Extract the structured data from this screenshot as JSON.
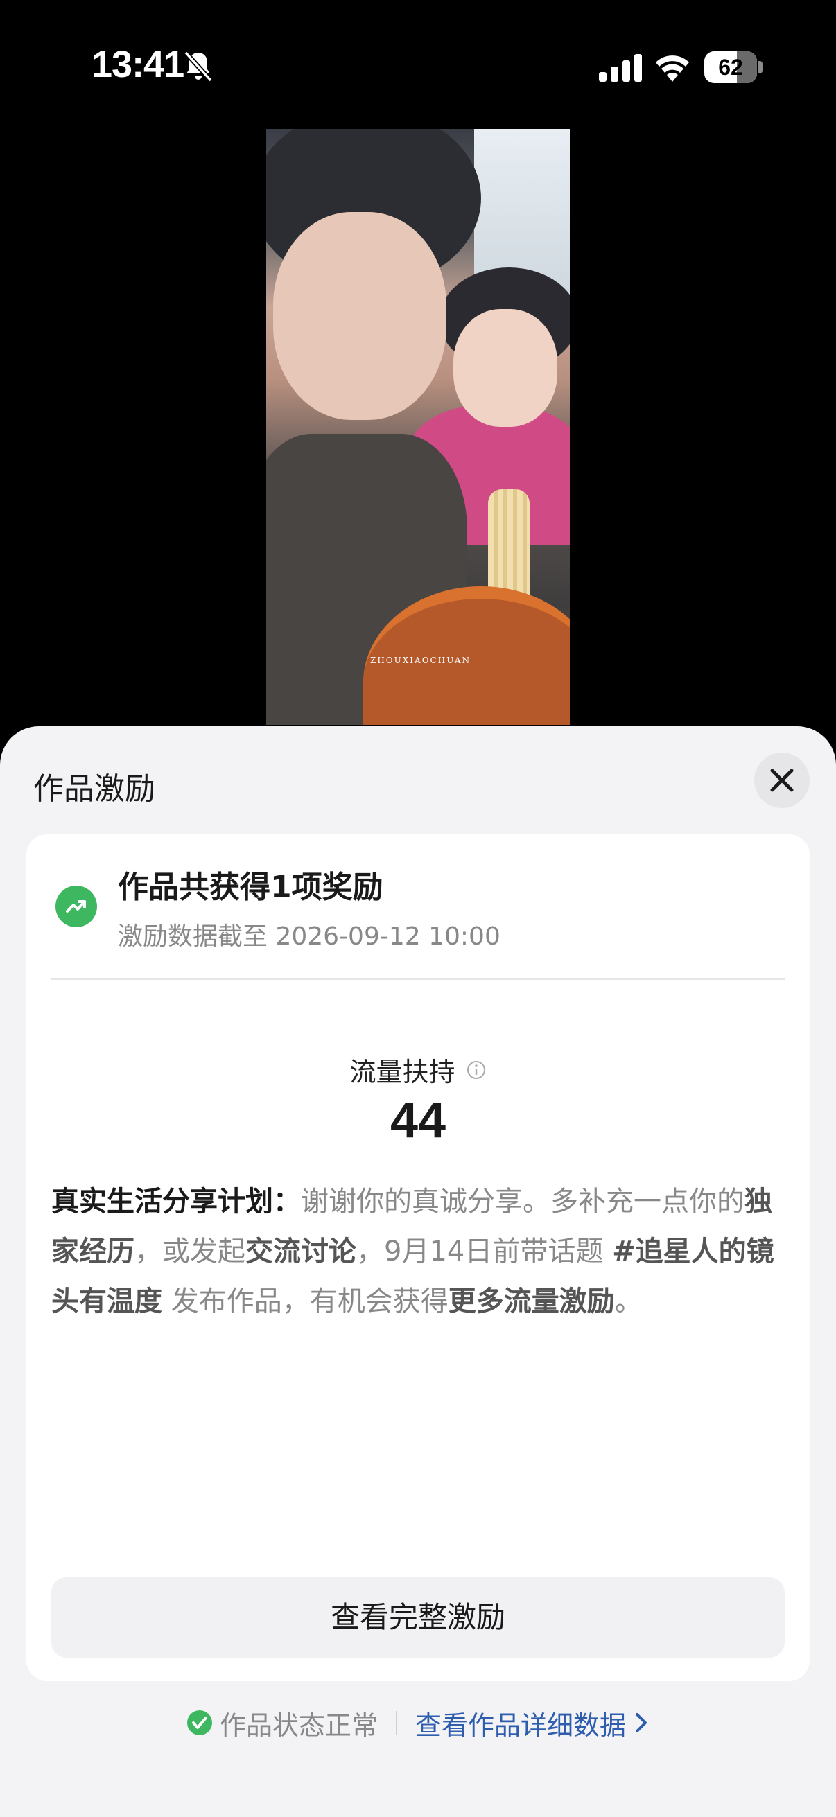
{
  "status_bar": {
    "time": "13:41",
    "battery_text": "62",
    "battery_level": 0.62,
    "icons": [
      "bell-slash-icon",
      "signal-icon",
      "wifi-icon",
      "battery-icon"
    ]
  },
  "video": {
    "watermark": "ZHOUXIAOCHUAN"
  },
  "sheet": {
    "title": "作品激励",
    "close_icon": "close-icon"
  },
  "reward": {
    "icon": "trend-up-icon",
    "title": "作品共获得1项奖励",
    "subtitle": "激励数据截至 2026-09-12 10:00",
    "metric_label": "流量扶持",
    "metric_value": "44"
  },
  "plan": {
    "t1": "真实生活分享计划：",
    "t2": "谢谢你的真诚分享。多补充一点你的",
    "t3": "独家经历",
    "t4": "，或发起",
    "t5": "交流讨论",
    "t6": "，9月14日前带话题 ",
    "t7": "#追星人的镜头有温度",
    "t8": " 发布作品，有机会获得",
    "t9": "更多流量激励",
    "t10": "。"
  },
  "buttons": {
    "view_full": "查看完整激励"
  },
  "footer": {
    "status_text": "作品状态正常",
    "link_text": "查看作品详细数据"
  },
  "colors": {
    "accent_green": "#3db760",
    "link_blue": "#2f5dae",
    "sheet_bg": "#f3f3f5"
  }
}
